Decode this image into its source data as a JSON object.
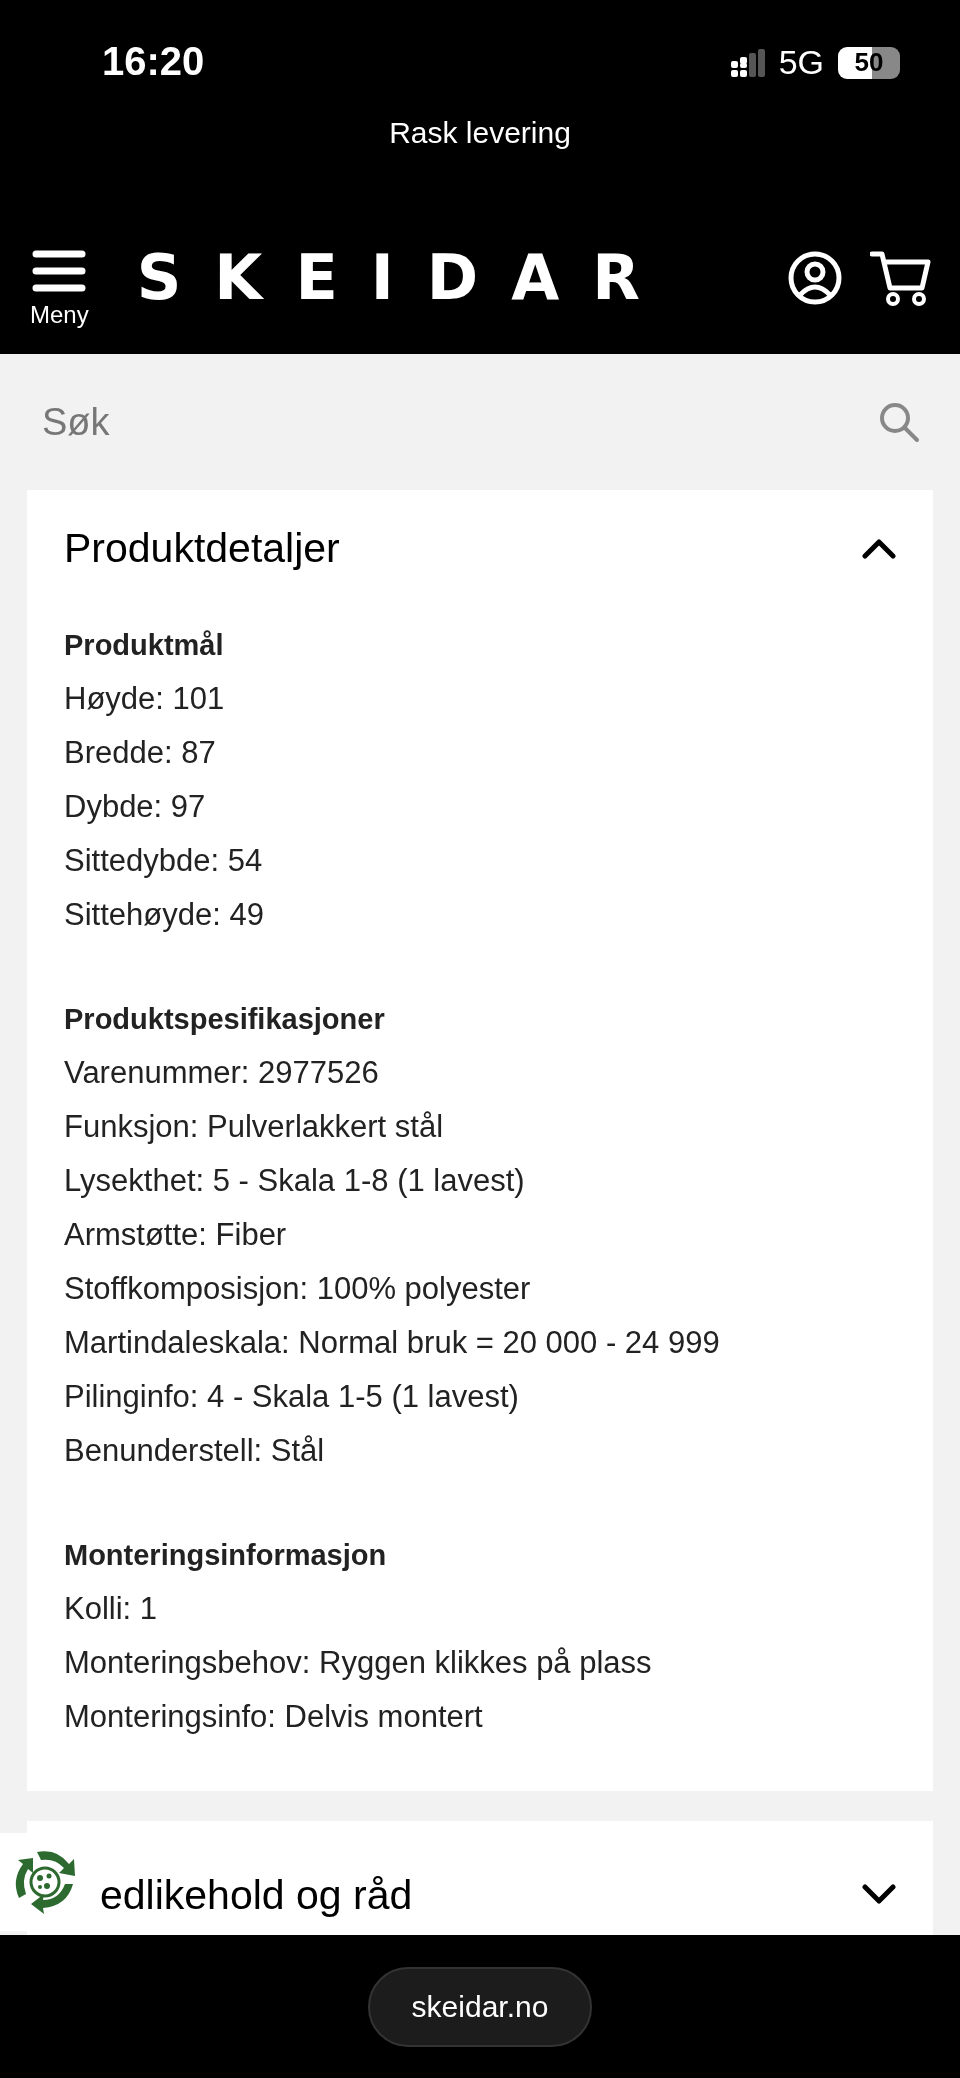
{
  "status_bar": {
    "time": "16:20",
    "network": "5G",
    "battery": "50"
  },
  "banner": {
    "text": "Rask levering"
  },
  "header": {
    "menu_label": "Meny",
    "logo": "SKEIDAR"
  },
  "search": {
    "placeholder": "Søk"
  },
  "panels": [
    {
      "title": "Produktdetaljer",
      "expanded": true,
      "sections": [
        {
          "heading": "Produktmål",
          "lines": [
            "Høyde: 101",
            "Bredde: 87",
            "Dybde: 97",
            "Sittedybde: 54",
            "Sittehøyde: 49"
          ]
        },
        {
          "heading": "Produktspesifikasjoner",
          "lines": [
            "Varenummer: 2977526",
            "Funksjon: Pulverlakkert stål",
            "Lysekthet: 5 - Skala 1-8 (1 lavest)",
            "Armstøtte: Fiber",
            "Stoffkomposisjon: 100% polyester",
            "Martindaleskala: Normal bruk = 20 000 - 24 999",
            "Pilinginfo: 4 - Skala 1-5 (1 lavest)",
            "Benunderstell: Stål"
          ]
        },
        {
          "heading": "Monteringsinformasjon",
          "lines": [
            "Kolli: 1",
            "Monteringsbehov: Ryggen klikkes på plass",
            "Monteringsinfo: Delvis montert"
          ]
        }
      ]
    },
    {
      "title": "edlikehold og råd",
      "expanded": false
    }
  ],
  "browser_bar": {
    "url": "skeidar.no"
  }
}
